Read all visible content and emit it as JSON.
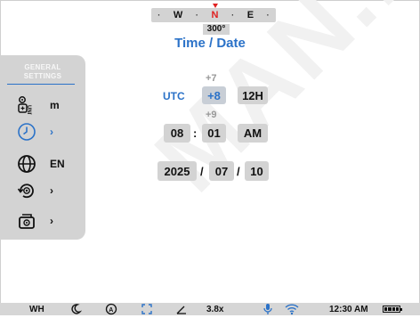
{
  "compass": {
    "dirs": [
      "W",
      "N",
      "E"
    ],
    "heading": "300°"
  },
  "title": "Time / Date",
  "sidebar": {
    "header_line1": "GENERAL",
    "header_line2": "SETTINGS",
    "items": [
      {
        "icon": "unit-icon",
        "value": "m"
      },
      {
        "icon": "clock-icon",
        "value": "›",
        "active": true
      },
      {
        "icon": "globe-icon",
        "value": "EN"
      },
      {
        "icon": "reset-icon",
        "value": "›"
      },
      {
        "icon": "device-icon",
        "value": "›"
      }
    ]
  },
  "timezone": {
    "label": "UTC",
    "prev": "+7",
    "value": "+8",
    "next": "+9",
    "format": "12H"
  },
  "time": {
    "hour": "08",
    "minute": "01",
    "ampm": "AM",
    "sep": ":"
  },
  "date": {
    "year": "2025",
    "month": "07",
    "day": "10",
    "sep": "/"
  },
  "status_bar": {
    "mode": "WH",
    "zoom": "3.8x",
    "clock": "12:30 AM"
  },
  "watermark": "MAN.R",
  "colors": {
    "accent": "#2b72c8",
    "panel": "#d3d3d3",
    "north": "#e02020"
  }
}
